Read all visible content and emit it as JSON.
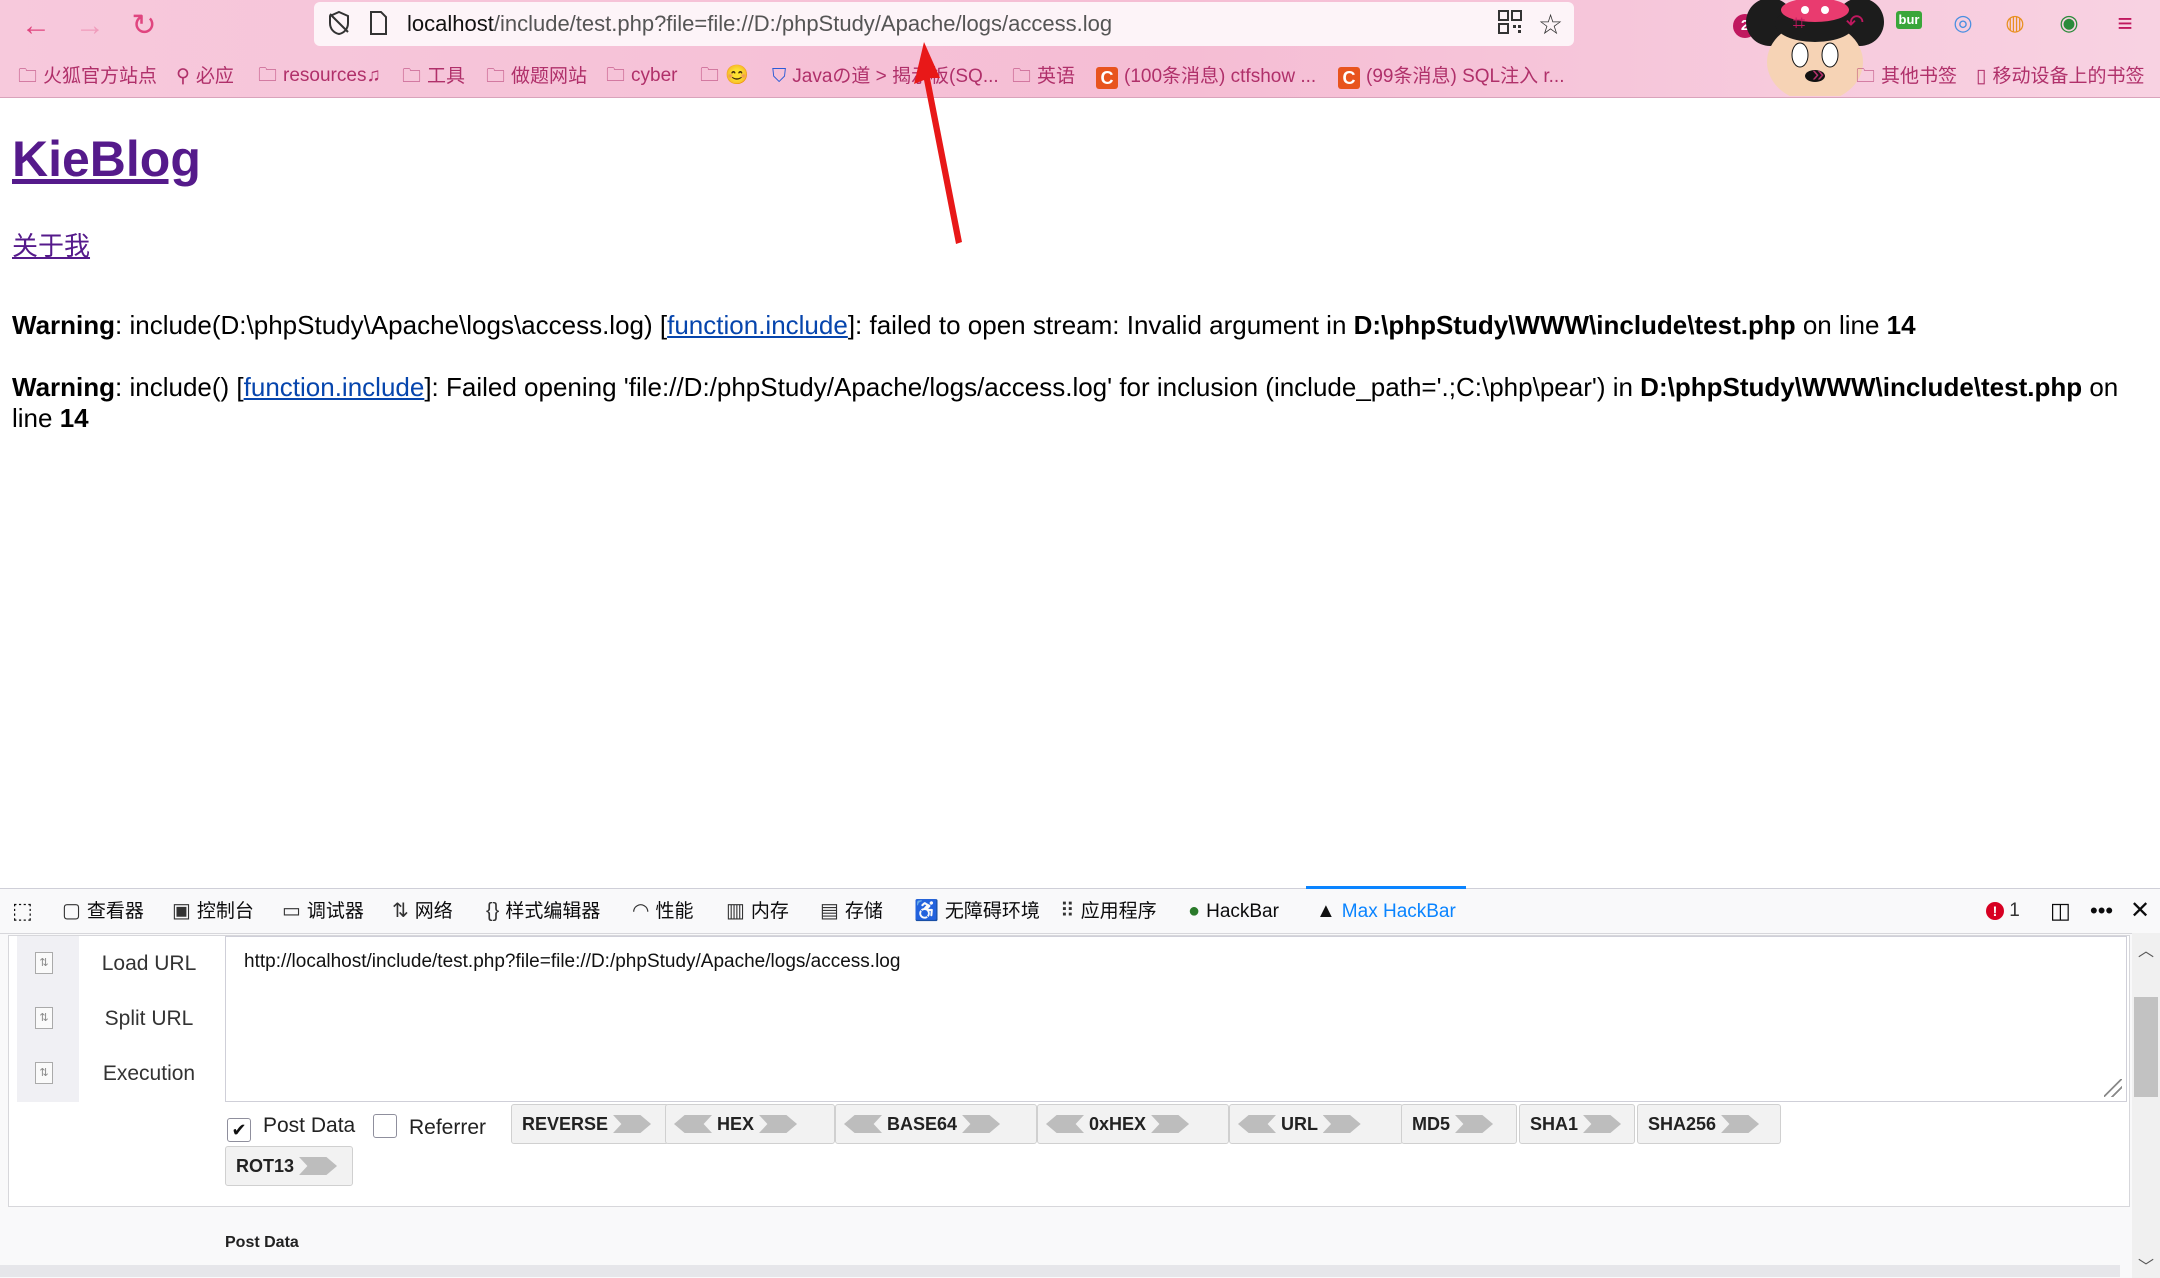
{
  "browser": {
    "url_host": "localhost",
    "url_path": "/include/test.php?file=file://D:/phpStudy/Apache/logs/access.log",
    "ext_badge_count": "2",
    "ext_bur_label": "bur",
    "bookmarks": [
      {
        "icon": "folder-icon",
        "label": "火狐官方站点"
      },
      {
        "icon": "search-icon",
        "label": "必应"
      },
      {
        "icon": "folder-icon",
        "label": "resources♫"
      },
      {
        "icon": "folder-icon",
        "label": "工具"
      },
      {
        "icon": "folder-icon",
        "label": "做题网站"
      },
      {
        "icon": "folder-icon",
        "label": "cyber"
      },
      {
        "icon": "folder-icon",
        "label": "😊"
      },
      {
        "icon": "shield-j-icon",
        "label": "Javaの道 > 揭示板(SQ..."
      },
      {
        "icon": "folder-icon",
        "label": "英语"
      },
      {
        "icon": "csdn-icon",
        "label": "(100条消息) ctfshow ..."
      },
      {
        "icon": "csdn-icon",
        "label": "(99条消息) SQL注入 r..."
      }
    ],
    "bookmarks_overflow": "»",
    "other_bookmarks": "其他书签",
    "mobile_bookmarks": "移动设备上的书签"
  },
  "page": {
    "site_title": "KieBlog",
    "about_link": "关于我",
    "warning1": {
      "label": "Warning",
      "pre": ": include(D:\\phpStudy\\Apache\\logs\\access.log) [",
      "link": "function.include",
      "mid": "]: failed to open stream: Invalid argument in ",
      "file": "D:\\phpStudy\\WWW\\include\\test.php",
      "on_line": " on line ",
      "line": "14"
    },
    "warning2": {
      "label": "Warning",
      "pre": ": include() [",
      "link": "function.include",
      "mid": "]: Failed opening 'file://D:/phpStudy/Apache/logs/access.log' for inclusion (include_path='.;C:\\php\\pear') in ",
      "file": "D:\\phpStudy\\WWW\\include\\test.php",
      "on_line": " on line ",
      "line": "14"
    }
  },
  "devtools": {
    "tabs": [
      {
        "icon": "inspector-icon",
        "label": "查看器"
      },
      {
        "icon": "console-icon",
        "label": "控制台"
      },
      {
        "icon": "debugger-icon",
        "label": "调试器"
      },
      {
        "icon": "network-icon",
        "label": "网络"
      },
      {
        "icon": "style-editor-icon",
        "label": "样式编辑器"
      },
      {
        "icon": "performance-icon",
        "label": "性能"
      },
      {
        "icon": "memory-icon",
        "label": "内存"
      },
      {
        "icon": "storage-icon",
        "label": "存储"
      },
      {
        "icon": "accessibility-icon",
        "label": "无障碍环境"
      },
      {
        "icon": "application-icon",
        "label": "应用程序"
      },
      {
        "icon": "hackbar-icon",
        "label": "HackBar"
      },
      {
        "icon": "max-hackbar-icon",
        "label": "Max HackBar"
      }
    ],
    "active_tab": "Max HackBar",
    "error_count": "1"
  },
  "hackbar": {
    "actions": [
      "Load URL",
      "Split URL",
      "Execution"
    ],
    "url_value": "http://localhost/include/test.php?file=file://D:/phpStudy/Apache/logs/access.log",
    "post_data_checkbox": {
      "label": "Post Data",
      "checked": true
    },
    "referrer_checkbox": {
      "label": "Referrer",
      "checked": false
    },
    "buttons": [
      "REVERSE",
      "HEX",
      "BASE64",
      "0xHEX",
      "URL",
      "MD5",
      "SHA1",
      "SHA256",
      "ROT13"
    ],
    "post_data_section_label": "Post Data"
  },
  "colors": {
    "chrome_pink": "#f7c9dc",
    "accent": "#e0457f",
    "link_visited": "#551a8b",
    "link": "#0645ad",
    "devtools_active": "#0a84ff",
    "annotation_arrow": "#e81818"
  }
}
